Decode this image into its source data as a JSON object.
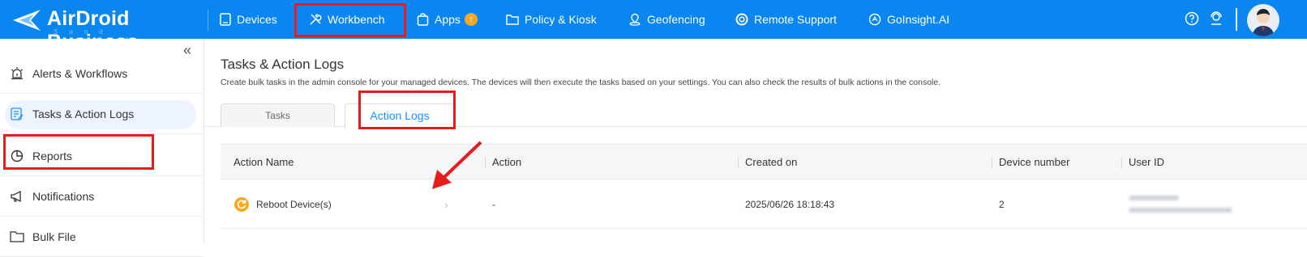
{
  "app": {
    "logo_text": "AirDroid Business",
    "logo_sub": "Sand Studio"
  },
  "nav": [
    {
      "label": "Devices",
      "icon": "tablet-icon"
    },
    {
      "label": "Workbench",
      "icon": "tools-icon"
    },
    {
      "label": "Apps",
      "icon": "apps-icon",
      "badge": "↑"
    },
    {
      "label": "Policy & Kiosk",
      "icon": "folder-icon"
    },
    {
      "label": "Geofencing",
      "icon": "map-pin-icon"
    },
    {
      "label": "Remote Support",
      "icon": "lifebuoy-icon"
    },
    {
      "label": "GoInsight.AI",
      "icon": "ai-icon"
    }
  ],
  "sidebar": {
    "collapse_glyph": "«",
    "items": [
      {
        "label": "Alerts & Workflows",
        "icon": "alarm-icon"
      },
      {
        "label": "Tasks & Action Logs",
        "icon": "task-list-icon",
        "active": true
      },
      {
        "label": "Reports",
        "icon": "pie-chart-icon"
      },
      {
        "label": "Notifications",
        "icon": "megaphone-icon"
      },
      {
        "label": "Bulk File",
        "icon": "folder-icon"
      }
    ]
  },
  "page": {
    "title": "Tasks & Action Logs",
    "description": "Create bulk tasks in the admin console for your managed devices. The devices will then execute the tasks based on your settings. You can also check the results of bulk actions in the console."
  },
  "tabs": [
    {
      "label": "Tasks",
      "active": false
    },
    {
      "label": "Action Logs",
      "active": true
    }
  ],
  "table": {
    "columns": [
      "Action Name",
      "Action",
      "Created on",
      "Device number",
      "User ID"
    ],
    "rows": [
      {
        "action_name": "Reboot Device(s)",
        "action": "-",
        "created_on": "2025/06/26 18:18:43",
        "device_number": "2",
        "user_id": "(redacted)"
      }
    ],
    "row_chevron": "›"
  },
  "colors": {
    "topbar": "#0a86f0",
    "accent": "#1890ff",
    "highlight": "#e81c1c",
    "reboot_icon": "#f6a821"
  }
}
